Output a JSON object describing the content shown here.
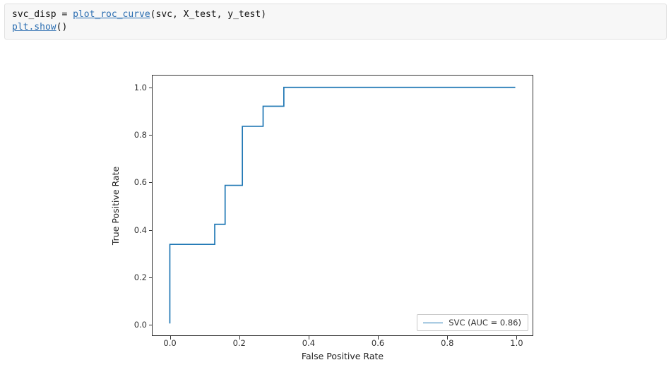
{
  "code": {
    "line1_pre": "svc_disp = ",
    "line1_fn": "plot_roc_curve",
    "line1_post": "(svc, X_test, y_test)",
    "line2_fn": "plt.show",
    "line2_post": "()"
  },
  "chart_data": {
    "type": "line",
    "title": "",
    "xlabel": "False Positive Rate",
    "ylabel": "True Positive Rate",
    "xlim": [
      -0.05,
      1.05
    ],
    "ylim": [
      -0.05,
      1.05
    ],
    "xticks": [
      0.0,
      0.2,
      0.4,
      0.6,
      0.8,
      1.0
    ],
    "yticks": [
      0.0,
      0.2,
      0.4,
      0.6,
      0.8,
      1.0
    ],
    "xtick_labels": [
      "0.0",
      "0.2",
      "0.4",
      "0.6",
      "0.8",
      "1.0"
    ],
    "ytick_labels": [
      "0.0",
      "0.2",
      "0.4",
      "0.6",
      "0.8",
      "1.0"
    ],
    "grid": false,
    "legend_position": "lower right",
    "series": [
      {
        "name": "SVC (AUC = 0.86)",
        "color": "#1f77b4",
        "x": [
          0.0,
          0.0,
          0.13,
          0.13,
          0.16,
          0.16,
          0.21,
          0.21,
          0.27,
          0.27,
          0.33,
          0.33,
          1.0
        ],
        "y": [
          0.0,
          0.335,
          0.335,
          0.42,
          0.42,
          0.585,
          0.585,
          0.835,
          0.835,
          0.92,
          0.92,
          1.0,
          1.0
        ]
      }
    ]
  }
}
